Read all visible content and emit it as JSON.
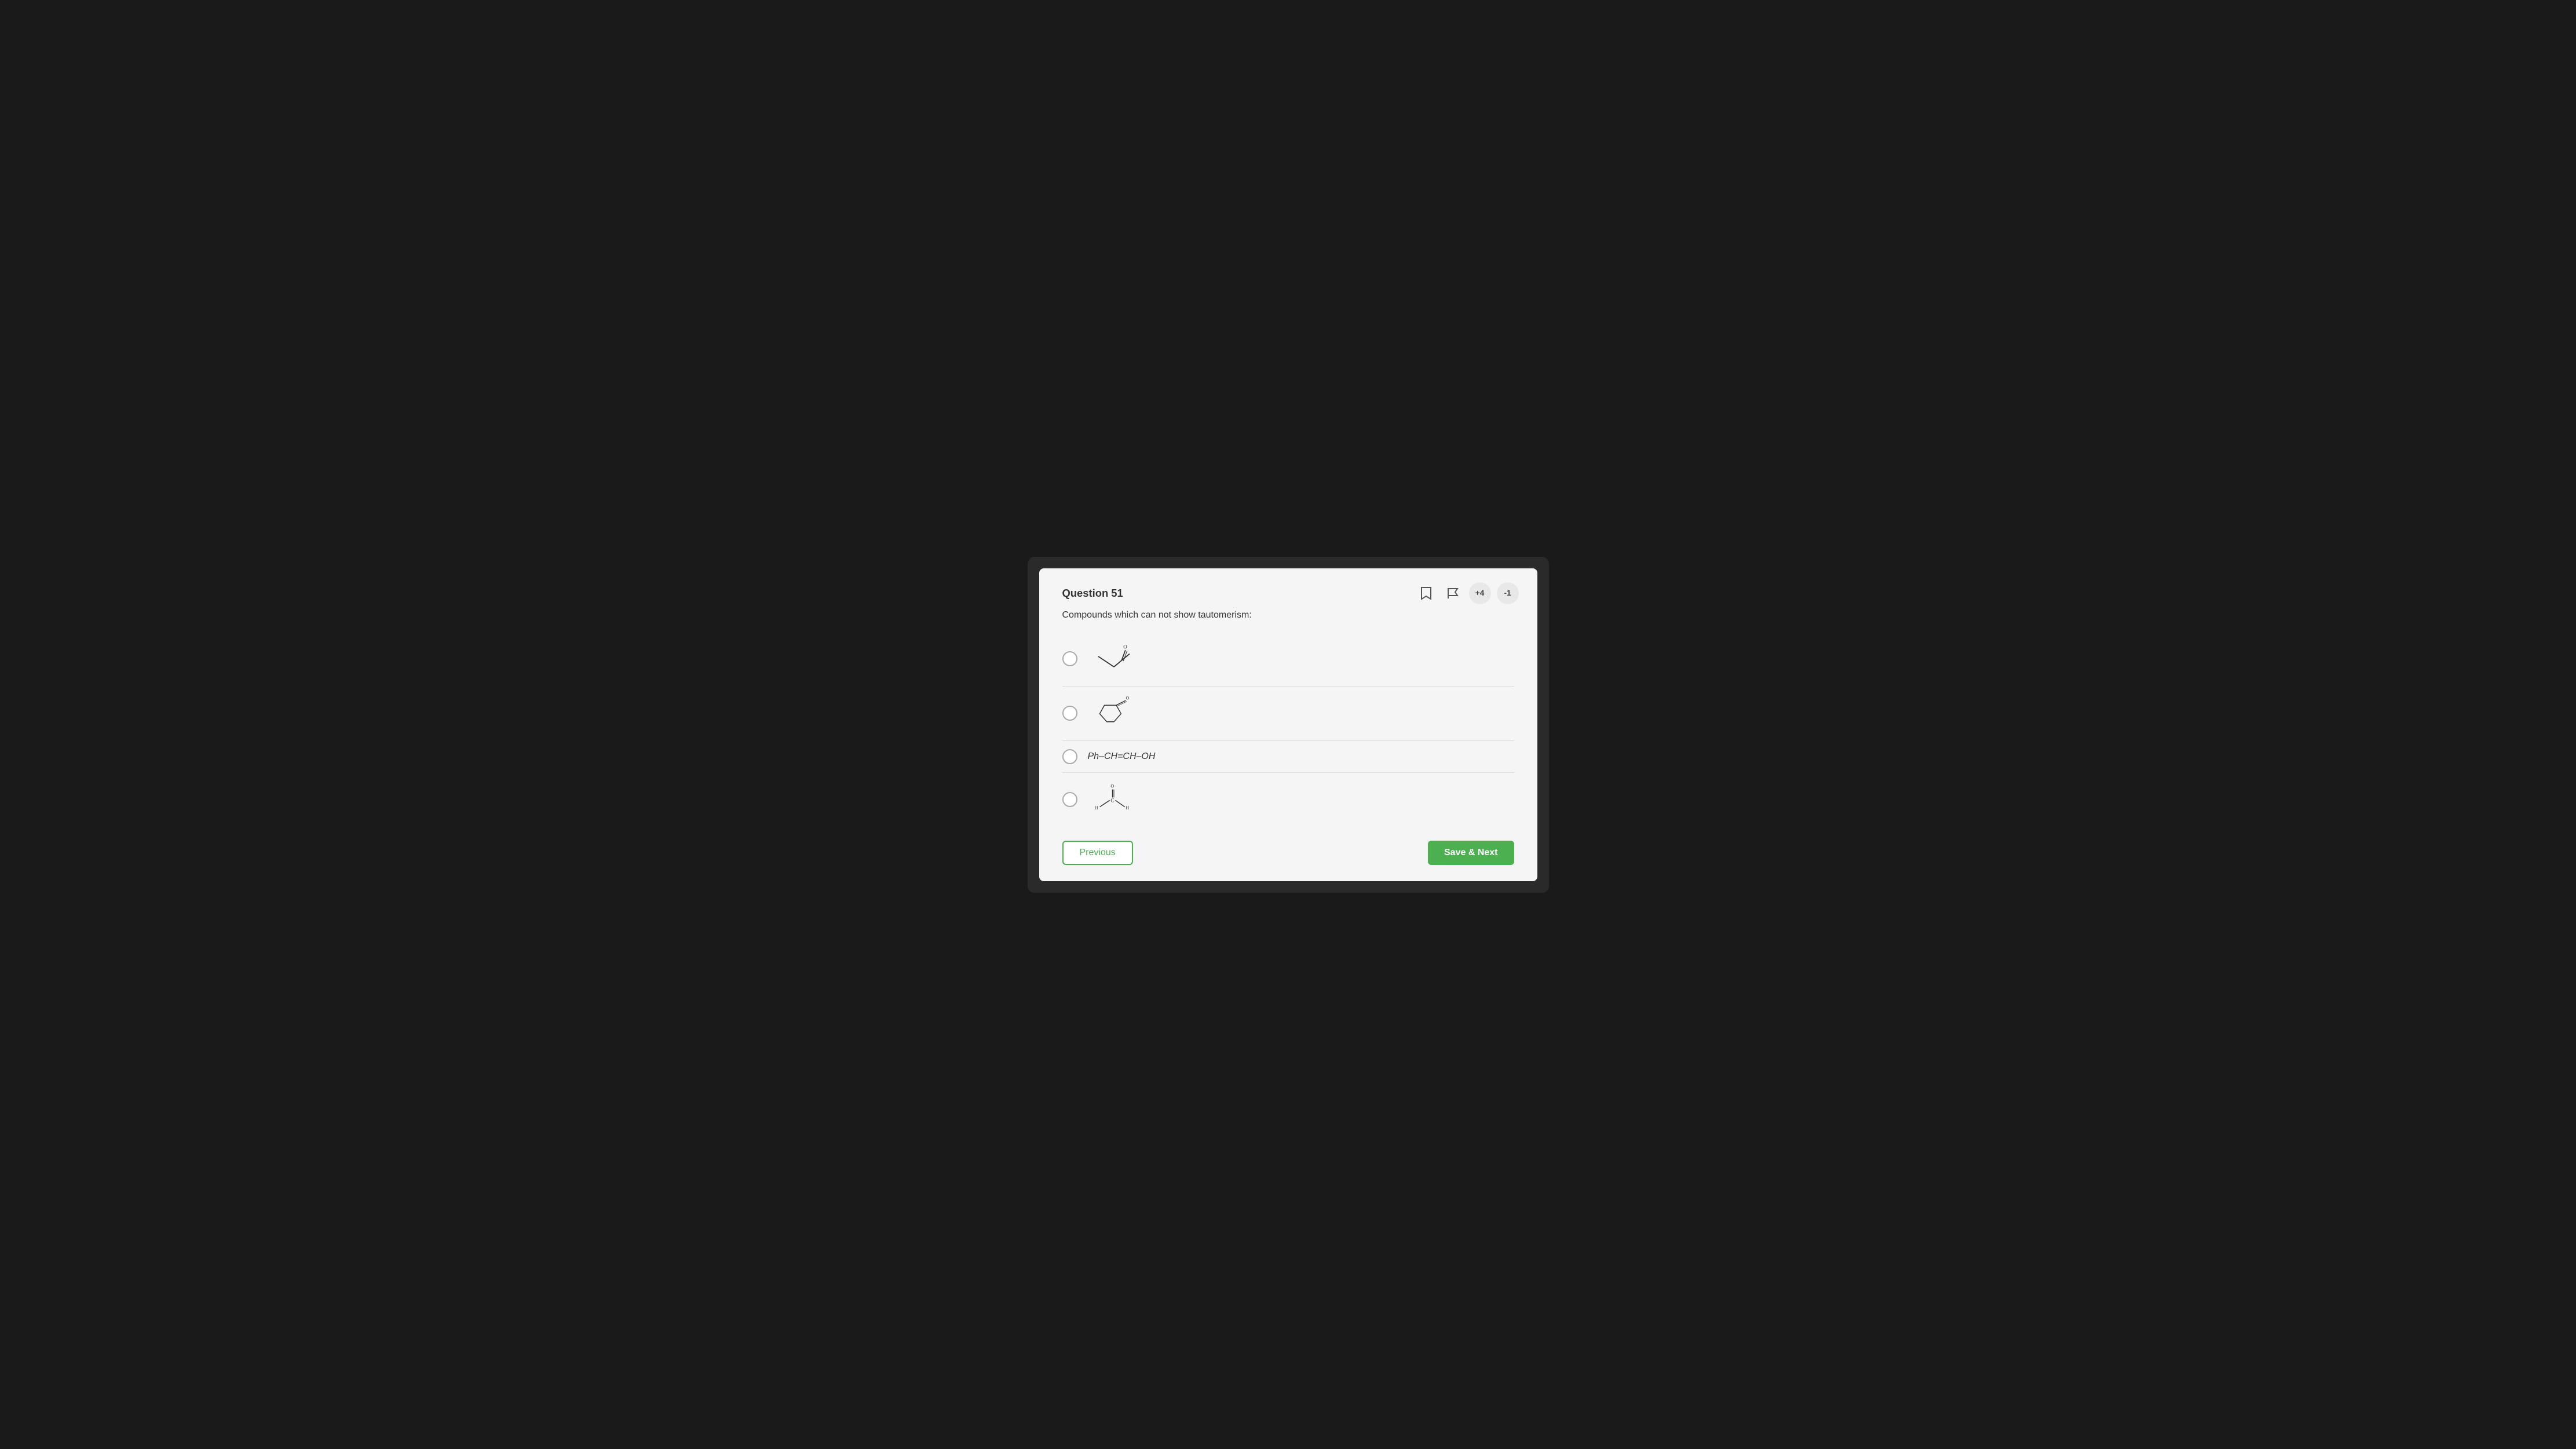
{
  "question": {
    "number": "Question 51",
    "text": "Compounds which can not show tautomerism:",
    "options": [
      {
        "id": "A",
        "type": "svg",
        "label": "methyl-vinyl-ketone"
      },
      {
        "id": "B",
        "type": "svg",
        "label": "bicyclo-ketone"
      },
      {
        "id": "C",
        "type": "text",
        "label": "Ph–CH=CH–OH"
      },
      {
        "id": "D",
        "type": "svg",
        "label": "formaldehyde"
      }
    ]
  },
  "toolbar": {
    "bookmark_icon": "🔖",
    "flag_icon": "🚩",
    "positive_score": "+4",
    "negative_score": "-1"
  },
  "buttons": {
    "previous": "Previous",
    "save_next": "Save & Next"
  },
  "colors": {
    "green": "#4caf50"
  }
}
